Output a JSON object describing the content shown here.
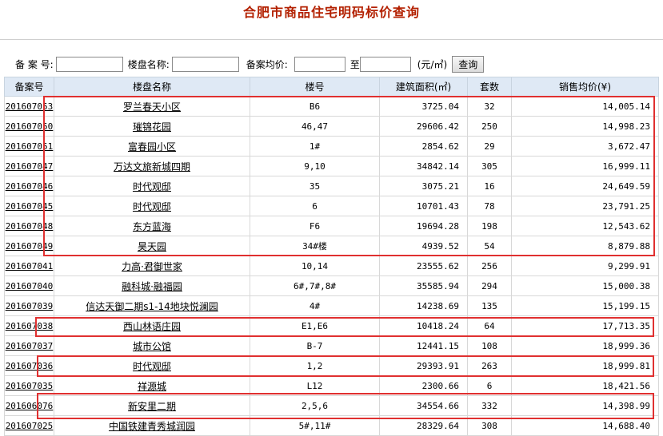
{
  "page": {
    "title": "合肥市商品住宅明码标价查询"
  },
  "search": {
    "id_label": "备 案 号:",
    "name_label": "楼盘名称:",
    "price_label": "备案均价:",
    "to_label": "至",
    "unit_label": "(元/㎡)",
    "button_label": "查询",
    "id_value": "",
    "name_value": "",
    "price_min": "",
    "price_max": ""
  },
  "table": {
    "headers": [
      "备案号",
      "楼盘名称",
      "楼号",
      "建筑面积(㎡)",
      "套数",
      "销售均价(¥)"
    ],
    "rows": [
      [
        "201607053",
        "罗兰春天小区",
        "B6",
        "3725.04",
        "32",
        "14,005.14"
      ],
      [
        "201607050",
        "璀锦花园",
        "46,47",
        "29606.42",
        "250",
        "14,998.23"
      ],
      [
        "201607051",
        "富春园小区",
        "1#",
        "2854.62",
        "29",
        "3,672.47"
      ],
      [
        "201607047",
        "万达文旅新城四期",
        "9,10",
        "34842.14",
        "305",
        "16,999.11"
      ],
      [
        "201607046",
        "时代观邸",
        "35",
        "3075.21",
        "16",
        "24,649.59"
      ],
      [
        "201607045",
        "时代观邸",
        "6",
        "10701.43",
        "78",
        "23,791.25"
      ],
      [
        "201607048",
        "东方蓝海",
        "F6",
        "19694.28",
        "198",
        "12,543.62"
      ],
      [
        "201607049",
        "昊天园",
        "34#楼",
        "4939.52",
        "54",
        "8,879.88"
      ],
      [
        "201607041",
        "力高·君御世家",
        "10,14",
        "23555.62",
        "256",
        "9,299.91"
      ],
      [
        "201607040",
        "融科城·融福园",
        "6#,7#,8#",
        "35585.94",
        "294",
        "15,000.38"
      ],
      [
        "201607039",
        "信达天御二期s1-14地块悦澜园",
        "4#",
        "14238.69",
        "135",
        "15,199.15"
      ],
      [
        "201607038",
        "西山林语庄园",
        "E1,E6",
        "10418.24",
        "64",
        "17,713.35"
      ],
      [
        "201607037",
        "城市公馆",
        "B-7",
        "12441.15",
        "108",
        "18,999.36"
      ],
      [
        "201607036",
        "时代观邸",
        "1,2",
        "29393.91",
        "263",
        "18,999.81"
      ],
      [
        "201607035",
        "祥源城",
        "L12",
        "2300.66",
        "6",
        "18,421.56"
      ],
      [
        "201606076",
        "新安里二期",
        "2,5,6",
        "34554.66",
        "332",
        "14,398.99"
      ],
      [
        "201607025",
        "中国铁建青秀城润园",
        "5#,11#",
        "28329.64",
        "308",
        "14,688.40"
      ]
    ]
  }
}
